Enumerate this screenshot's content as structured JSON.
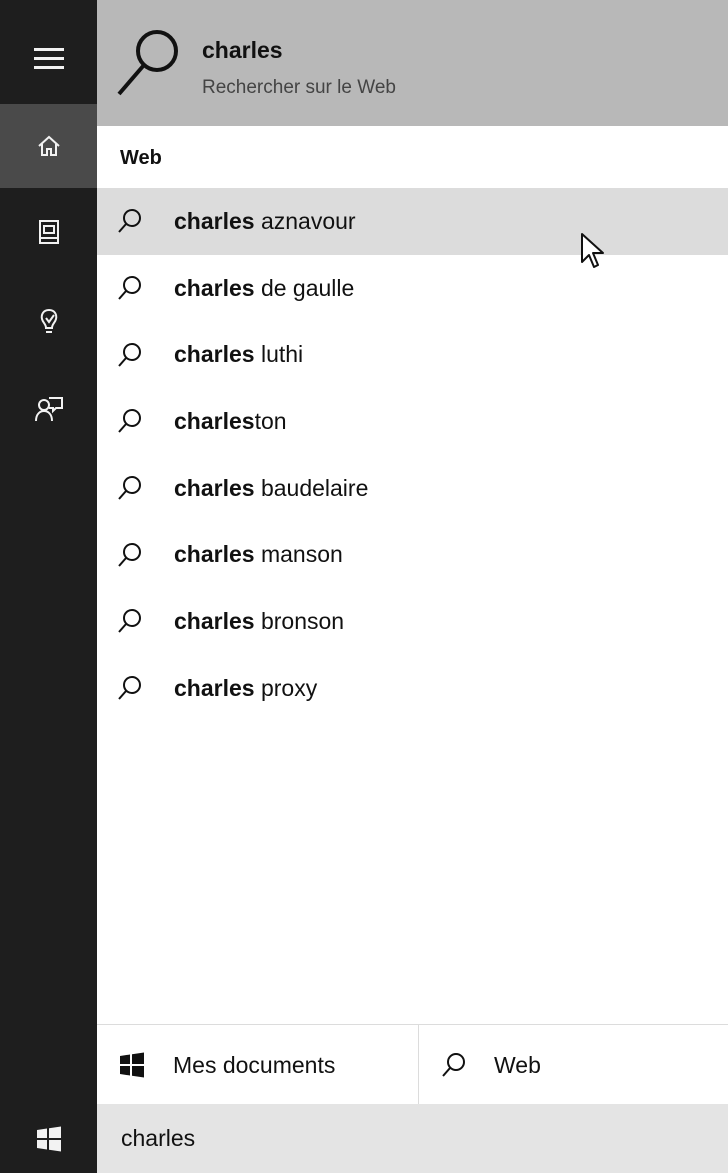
{
  "header": {
    "query": "charles",
    "subtitle": "Rechercher sur le Web"
  },
  "section_label": "Web",
  "results": [
    {
      "bold": "charles",
      "rest": " aznavour"
    },
    {
      "bold": "charles",
      "rest": " de gaulle"
    },
    {
      "bold": "charles",
      "rest": " luthi"
    },
    {
      "bold": "charles",
      "rest": "ton"
    },
    {
      "bold": "charles",
      "rest": " baudelaire"
    },
    {
      "bold": "charles",
      "rest": " manson"
    },
    {
      "bold": "charles",
      "rest": " bronson"
    },
    {
      "bold": "charles",
      "rest": " proxy"
    }
  ],
  "tabs": {
    "documents": "Mes documents",
    "web": "Web"
  },
  "taskbar": {
    "search_value": "charles"
  },
  "rail_icons": [
    "hamburger-icon",
    "home-icon",
    "notebook-icon",
    "lightbulb-icon",
    "feedback-icon"
  ],
  "colors": {
    "rail": "#1e1e1e",
    "rail_active": "#4a4a4a",
    "header": "#b8b8b8",
    "hover_row": "#dcdcdc",
    "taskbar_search": "#e4e4e4"
  }
}
